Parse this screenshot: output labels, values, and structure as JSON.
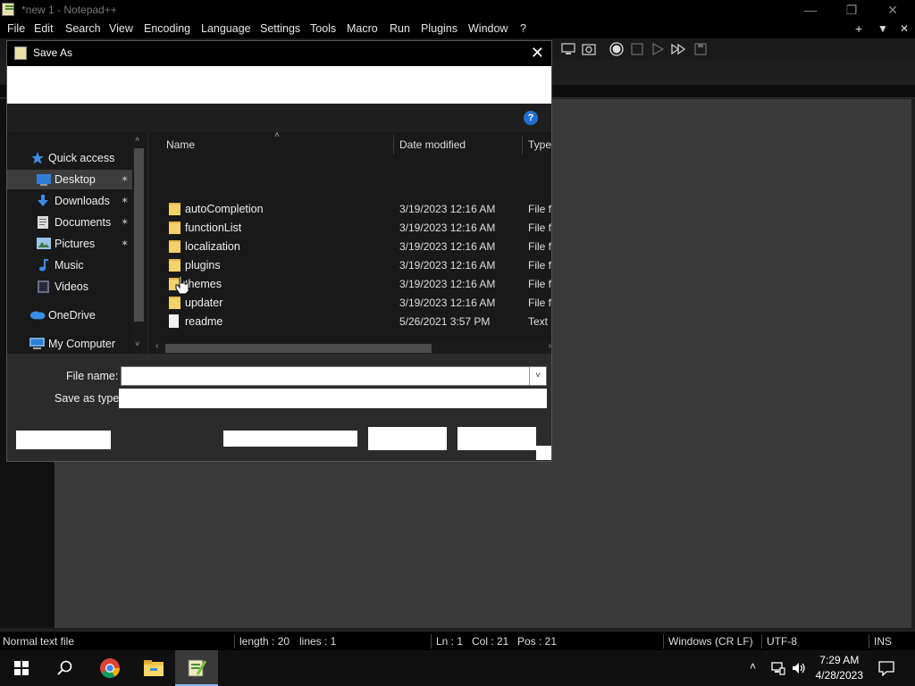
{
  "window": {
    "title": "*new 1 - Notepad++",
    "controls": {
      "minimize": "—",
      "restore": "❐",
      "close": "✕"
    }
  },
  "menu": {
    "items": [
      "File",
      "Edit",
      "Search",
      "View",
      "Encoding",
      "Language",
      "Settings",
      "Tools",
      "Macro",
      "Run",
      "Plugins",
      "Window",
      "?"
    ],
    "right": {
      "plus": "+",
      "down": "▼",
      "close": "✕"
    }
  },
  "dialog": {
    "title": "Save As",
    "close_glyph": "✕",
    "help_glyph": "?",
    "nav": [
      {
        "label": "Quick access",
        "icon": "star-icon",
        "pinned": false,
        "selected": false
      },
      {
        "label": "Desktop",
        "icon": "desktop-icon",
        "pinned": true,
        "selected": true
      },
      {
        "label": "Downloads",
        "icon": "download-icon",
        "pinned": true,
        "selected": false
      },
      {
        "label": "Documents",
        "icon": "document-icon",
        "pinned": true,
        "selected": false
      },
      {
        "label": "Pictures",
        "icon": "pictures-icon",
        "pinned": true,
        "selected": false
      },
      {
        "label": "Music",
        "icon": "music-icon",
        "pinned": false,
        "selected": false
      },
      {
        "label": "Videos",
        "icon": "videos-icon",
        "pinned": false,
        "selected": false
      },
      {
        "label": "OneDrive",
        "icon": "cloud-icon",
        "pinned": false,
        "selected": false
      },
      {
        "label": "My Computer",
        "icon": "computer-icon",
        "pinned": false,
        "selected": false
      }
    ],
    "columns": {
      "name": "Name",
      "date": "Date modified",
      "type": "Type"
    },
    "files": [
      {
        "name": "autoCompletion",
        "date": "3/19/2023 12:16 AM",
        "type": "File folder",
        "kind": "folder"
      },
      {
        "name": "functionList",
        "date": "3/19/2023 12:16 AM",
        "type": "File folder",
        "kind": "folder"
      },
      {
        "name": "localization",
        "date": "3/19/2023 12:16 AM",
        "type": "File folder",
        "kind": "folder"
      },
      {
        "name": "plugins",
        "date": "3/19/2023 12:16 AM",
        "type": "File folder",
        "kind": "folder"
      },
      {
        "name": "themes",
        "date": "3/19/2023 12:16 AM",
        "type": "File folder",
        "kind": "folder"
      },
      {
        "name": "updater",
        "date": "3/19/2023 12:16 AM",
        "type": "File folder",
        "kind": "folder"
      },
      {
        "name": "readme",
        "date": "5/26/2021 3:57 PM",
        "type": "Text Document",
        "kind": "file"
      }
    ],
    "file_name_label": "File name:",
    "file_name_value": "",
    "save_as_type_label": "Save as type:",
    "save_as_type_value": ""
  },
  "status": {
    "type": "Normal text file",
    "length": "length : 20",
    "lines": "lines : 1",
    "ln": "Ln : 1",
    "col": "Col : 21",
    "pos": "Pos : 21",
    "eol": "Windows (CR LF)",
    "encoding": "UTF-8",
    "mode": "INS"
  },
  "taskbar": {
    "time": "7:29 AM",
    "date": "4/28/2023"
  },
  "colors": {
    "accent": "#1f6fd1",
    "folder": "#f3d26b"
  }
}
